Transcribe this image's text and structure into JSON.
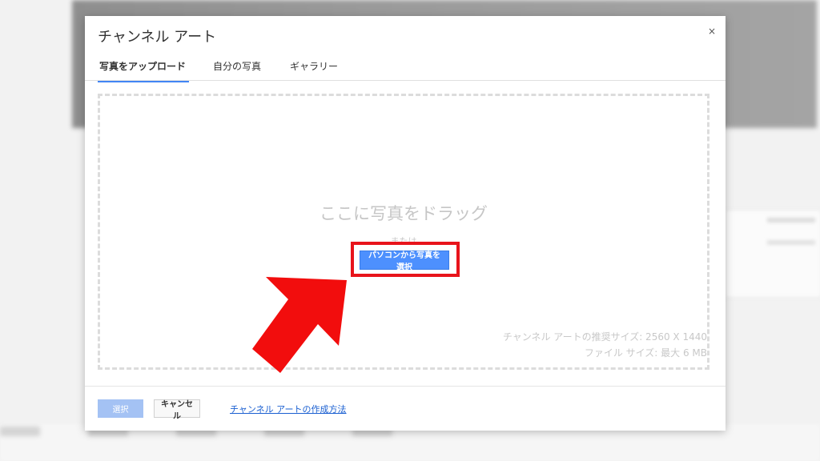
{
  "dialog": {
    "title": "チャンネル アート",
    "close_symbol": "×",
    "tabs": [
      {
        "label": "写真をアップロード",
        "active": true
      },
      {
        "label": "自分の写真",
        "active": false
      },
      {
        "label": "ギャラリー",
        "active": false
      }
    ],
    "dropzone": {
      "title": "ここに写真をドラッグ",
      "or_text": "または",
      "upload_button_label": "パソコンから写真を選択",
      "recommended_size": "チャンネル アートの推奨サイズ: 2560 X 1440",
      "max_file_size": "ファイル サイズ: 最大 6 MB"
    },
    "footer": {
      "select_label": "選択",
      "cancel_label": "キャンセル",
      "help_link": "チャンネル アートの作成方法"
    }
  },
  "annotation": {
    "highlight_color": "#e8141b",
    "arrow_color": "#f20d0d",
    "arrow_icon": "arrow-up-right-icon"
  },
  "theme": {
    "accent": "#4285f4",
    "button_blue": "#4d90fe",
    "disabled_blue": "#a4c2f4",
    "link": "#1a5fd1"
  }
}
